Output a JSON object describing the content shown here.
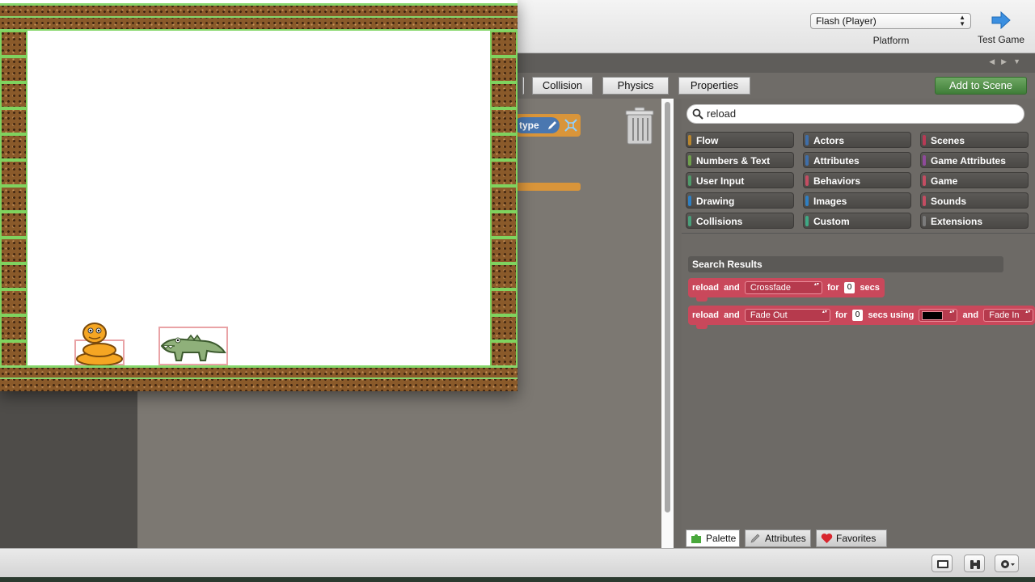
{
  "toolbar": {
    "platform_value": "Flash (Player)",
    "platform_label": "Platform",
    "test_game_label": "Test Game"
  },
  "tabs": {
    "collision": "Collision",
    "physics": "Physics",
    "properties": "Properties"
  },
  "add_to_scene": "Add to Scene",
  "editor": {
    "type_label": "type"
  },
  "search": {
    "value": "reload"
  },
  "categories": [
    {
      "label": "Flow",
      "color": "#b8862e"
    },
    {
      "label": "Actors",
      "color": "#3f6ea8"
    },
    {
      "label": "Scenes",
      "color": "#b83a55"
    },
    {
      "label": "Numbers & Text",
      "color": "#6fa04d"
    },
    {
      "label": "Attributes",
      "color": "#3f6ea8"
    },
    {
      "label": "Game Attributes",
      "color": "#8f4a9a"
    },
    {
      "label": "User Input",
      "color": "#4f9a6a"
    },
    {
      "label": "Behaviors",
      "color": "#c44d62"
    },
    {
      "label": "Game",
      "color": "#c44d62"
    },
    {
      "label": "Drawing",
      "color": "#2f7fc2"
    },
    {
      "label": "Images",
      "color": "#2f7fc2"
    },
    {
      "label": "Sounds",
      "color": "#c44d62"
    },
    {
      "label": "Collisions",
      "color": "#4a9f7a"
    },
    {
      "label": "Custom",
      "color": "#3fa884"
    },
    {
      "label": "Extensions",
      "color": "#7b7b7b"
    }
  ],
  "search_results": {
    "title": "Search Results",
    "block1": {
      "w1": "reload",
      "w2": "and",
      "transition": "Crossfade",
      "w3": "for",
      "secs": "0",
      "w4": "secs"
    },
    "block2": {
      "w1": "reload",
      "w2": "and",
      "transition": "Fade Out",
      "w3": "for",
      "secs": "0",
      "w4": "secs using",
      "w5": "and",
      "transition2": "Fade In"
    }
  },
  "palette_tabs": {
    "palette": "Palette",
    "attributes": "Attributes",
    "favorites": "Favorites"
  },
  "colors": {
    "accent_green": "#3f7d38",
    "block_red": "#c9485b",
    "block_orange": "#d9953a"
  }
}
